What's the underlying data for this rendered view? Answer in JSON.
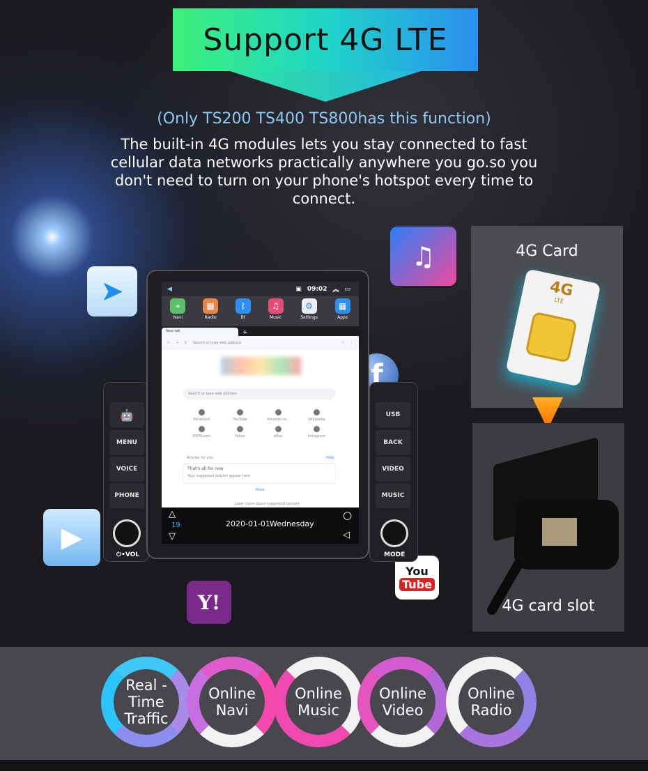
{
  "header": {
    "title": "Support 4G LTE",
    "note": "(Only TS200 TS400 TS800has this function)",
    "description": "The built-in 4G modules lets you stay connected to fast cellular data networks practically anywhere you go.so you don't need to turn on your phone's hotspot every time to connect."
  },
  "panels": {
    "card_title": "4G Card",
    "sim_label": "4G",
    "sim_sub": "LTE",
    "slot_title": "4G card slot"
  },
  "device": {
    "status": {
      "time": "09:02"
    },
    "apps": [
      {
        "label": "Navi",
        "icon": "map-pin",
        "color": "#5cbf6a"
      },
      {
        "label": "Radio",
        "icon": "radio",
        "color": "#e8844a"
      },
      {
        "label": "Bt",
        "icon": "bluetooth",
        "color": "#2d8ff0"
      },
      {
        "label": "Music",
        "icon": "music-note",
        "color": "#e84d75"
      },
      {
        "label": "Settings",
        "icon": "gear",
        "color": "#e9eef4"
      },
      {
        "label": "Apps",
        "icon": "grid",
        "color": "#2d8ff0"
      }
    ],
    "browser": {
      "tab": "New tab",
      "address_placeholder": "Search or type web address",
      "search_placeholder": "Search or type web address",
      "shortcuts": [
        "Facebook",
        "YouTube",
        "Amazon.co...",
        "Wikipedia",
        "ESPN.com",
        "Yahoo",
        "eBay",
        "Instagram"
      ],
      "articles_label": "Articles for you",
      "hide": "Hide",
      "empty_title": "That's all for now",
      "empty_sub": "Your suggested articles appear here",
      "more": "More",
      "learn_more": "Learn more about suggested content"
    },
    "bottom": {
      "temp": "19",
      "date": "2020-01-01",
      "day": "Wednesday"
    },
    "left_keys": [
      "MENU",
      "VOICE",
      "PHONE"
    ],
    "left_knob": "⏻•VOL",
    "right_keys": [
      "USB",
      "BACK",
      "VIDEO",
      "MUSIC"
    ],
    "right_knob": "MODE"
  },
  "floating_icons": {
    "youtube_top": "You",
    "youtube_bottom": "Tube",
    "yahoo": "Y!",
    "facebook": "f"
  },
  "features": [
    "Real -Time Traffic",
    "Online Navi",
    "Online Music",
    "Online Video",
    "Online Radio"
  ]
}
